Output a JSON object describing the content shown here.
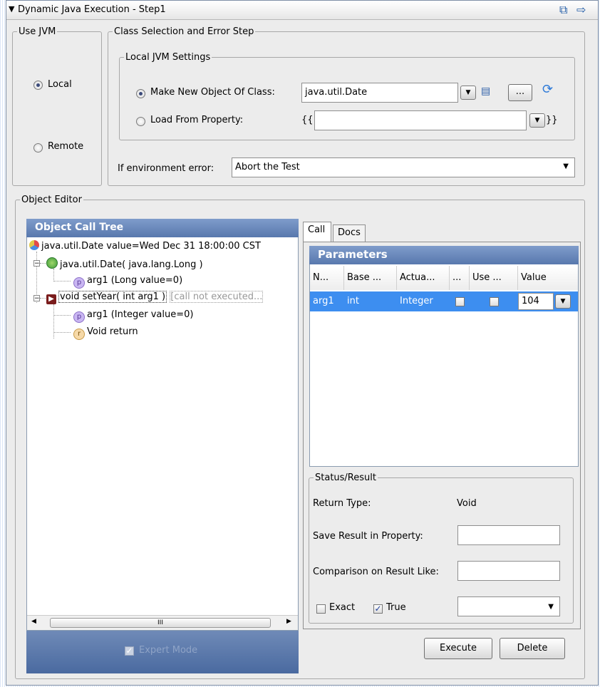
{
  "window": {
    "title": "Dynamic Java Execution - Step1",
    "collapse_glyph": "▼",
    "icons": [
      "float-window-icon",
      "dock-arrow-icon"
    ]
  },
  "use_jvm": {
    "legend": "Use JVM",
    "local_label": "Local",
    "remote_label": "Remote",
    "selected": "Local"
  },
  "class_selection": {
    "legend": "Class Selection and Error Step",
    "local_settings": {
      "legend": "Local JVM Settings",
      "make_new_label": "Make New Object Of Class:",
      "class_value": "java.util.Date",
      "load_from_label": "Load From Property:",
      "load_from_value": "",
      "open_brace": "{{",
      "close_brace": "}}",
      "browse_label": "...",
      "selected": "Make New Object Of Class:"
    },
    "env_error_label": "If environment error:",
    "env_error_value": "Abort the Test"
  },
  "object_editor": {
    "legend": "Object Editor",
    "tree": {
      "header": "Object Call Tree",
      "nodes": [
        {
          "text": "java.util.Date value=Wed Dec 31 18:00:00 CST"
        },
        {
          "text": "java.util.Date( java.lang.Long )"
        },
        {
          "badge": "p",
          "text": "arg1 (Long value=0)"
        },
        {
          "text": "void setYear( int arg1 )",
          "note": "[call not executed..."
        },
        {
          "badge": "p",
          "text": "arg1 (Integer value=0)"
        },
        {
          "badge": "r",
          "text": "Void return"
        }
      ],
      "scroll_thumb_glyph": "III",
      "expert_mode_label": "Expert Mode"
    },
    "tabs": [
      {
        "label": "Call",
        "active": true
      },
      {
        "label": "Docs",
        "active": false
      }
    ],
    "parameters": {
      "header": "Parameters",
      "columns": [
        "N...",
        "Base ...",
        "Actua...",
        "...",
        "Use ...",
        "Value"
      ],
      "row": {
        "name": "arg1",
        "base": "int",
        "actual": "Integer",
        "value": "104"
      }
    },
    "status": {
      "legend": "Status/Result",
      "return_type_label": "Return Type:",
      "return_type_value": "Void",
      "save_result_label": "Save Result in Property:",
      "comparison_label": "Comparison on Result Like:",
      "exact_label": "Exact",
      "true_label": "True",
      "exact_checked": false,
      "true_checked": true
    },
    "buttons": {
      "execute": "Execute",
      "delete": "Delete"
    }
  },
  "colors": {
    "header_blue": "#5878ad",
    "selection_blue": "#3d8ef0"
  }
}
